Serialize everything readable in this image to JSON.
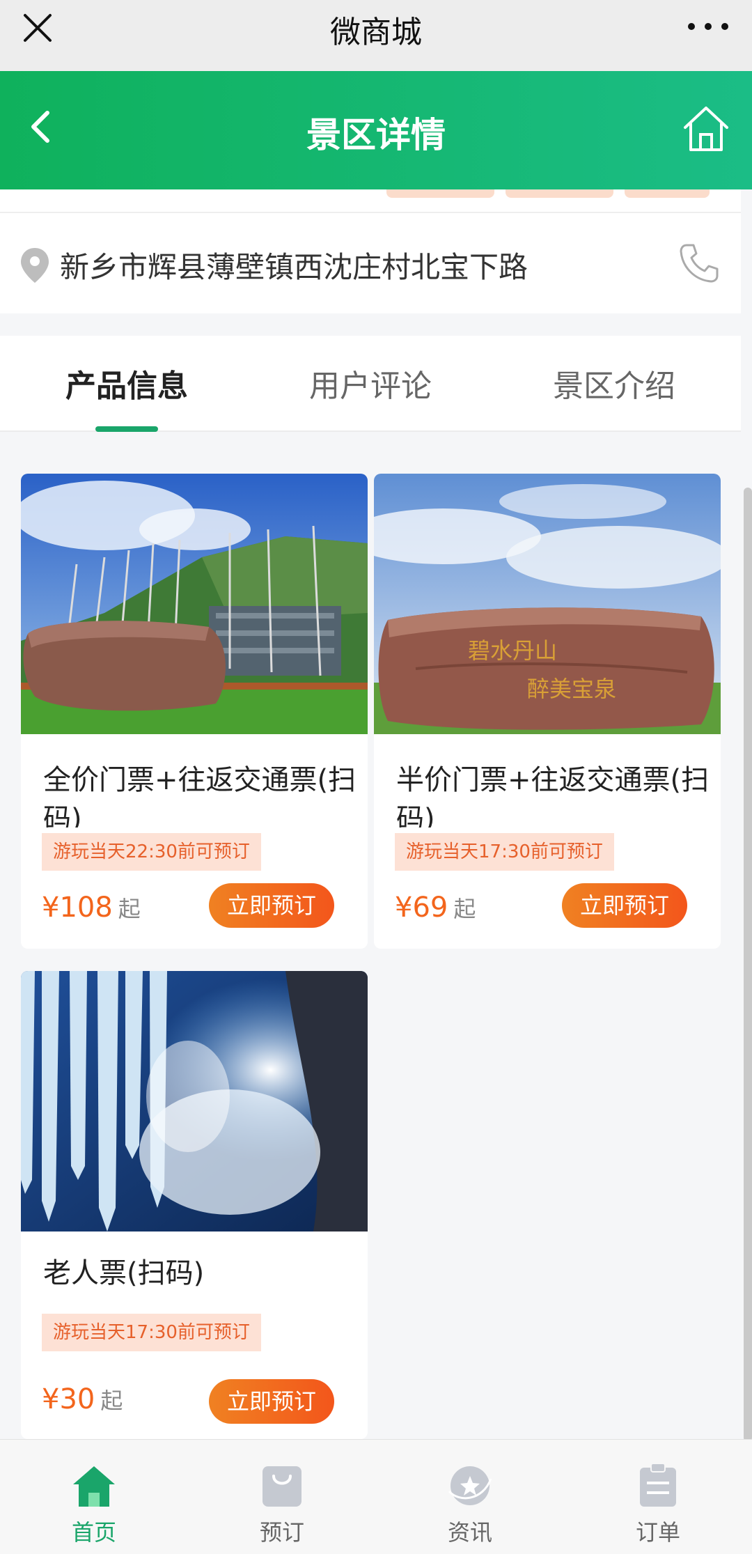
{
  "wechat_bar": {
    "title": "微商城"
  },
  "header": {
    "title": "景区详情"
  },
  "address": {
    "text": "新乡市辉县薄壁镇西沈庄村北宝下路"
  },
  "tabs": [
    {
      "label": "产品信息",
      "active": true
    },
    {
      "label": "用户评论",
      "active": false
    },
    {
      "label": "景区介绍",
      "active": false
    }
  ],
  "products": [
    {
      "name": "全价门票+往返交通票(扫码)",
      "tip": "游玩当天22:30前可预订",
      "price": "¥108",
      "unit": "起",
      "button": "立即预订"
    },
    {
      "name": "半价门票+往返交通票(扫码)",
      "tip": "游玩当天17:30前可预订",
      "price": "¥69",
      "unit": "起",
      "button": "立即预订"
    },
    {
      "name": "老人票(扫码)",
      "tip": "游玩当天17:30前可预订",
      "price": "¥30",
      "unit": "起",
      "button": "立即预订"
    }
  ],
  "bottom_nav": [
    {
      "label": "首页",
      "icon": "home-icon",
      "active": true
    },
    {
      "label": "预订",
      "icon": "bag-icon",
      "active": false
    },
    {
      "label": "资讯",
      "icon": "news-icon",
      "active": false
    },
    {
      "label": "订单",
      "icon": "clipboard-icon",
      "active": false
    }
  ],
  "colors": {
    "brand_green": "#1aa56a",
    "price_orange": "#f3651c",
    "button_orange": "#f3561b"
  }
}
